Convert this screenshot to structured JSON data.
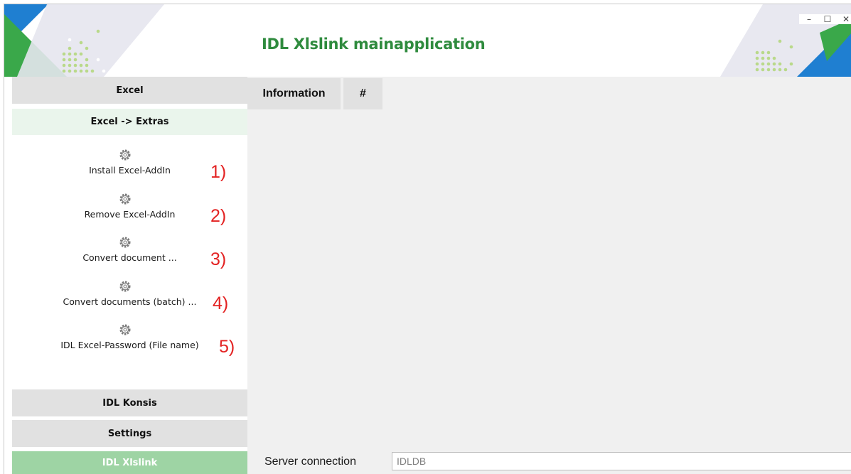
{
  "app": {
    "title": "IDL Xlslink mainapplication"
  },
  "window_controls": {
    "minimize": "–",
    "maximize": "☐",
    "close": "✕"
  },
  "sidebar": {
    "sections": {
      "excel": "Excel",
      "excel_extras": "Excel -> Extras",
      "idl_konsis": "IDL Konsis",
      "settings": "Settings",
      "idl_xlslink": "IDL Xlslink"
    },
    "actions": [
      {
        "label": "Install Excel-AddIn",
        "marker": "1)",
        "icon": "gear-icon"
      },
      {
        "label": "Remove Excel-AddIn",
        "marker": "2)",
        "icon": "gear-icon"
      },
      {
        "label": "Convert document ...",
        "marker": "3)",
        "icon": "gear-icon"
      },
      {
        "label": "Convert documents (batch) ...",
        "marker": "4)",
        "icon": "gear-icon"
      },
      {
        "label": "IDL Excel-Password (File name)",
        "marker": "5)",
        "icon": "gear-icon"
      }
    ]
  },
  "main": {
    "tabs": [
      {
        "label": "Information"
      },
      {
        "label": "#"
      }
    ]
  },
  "statusbar": {
    "label": "Server connection",
    "value": "IDLDB"
  },
  "colors": {
    "title_green": "#2f8b3e",
    "active_section": "#9ed4a4",
    "sub_section": "#eaf5ec",
    "marker_red": "#e32222",
    "logo_blue": "#1f7fd1",
    "logo_green": "#3aa84a"
  }
}
